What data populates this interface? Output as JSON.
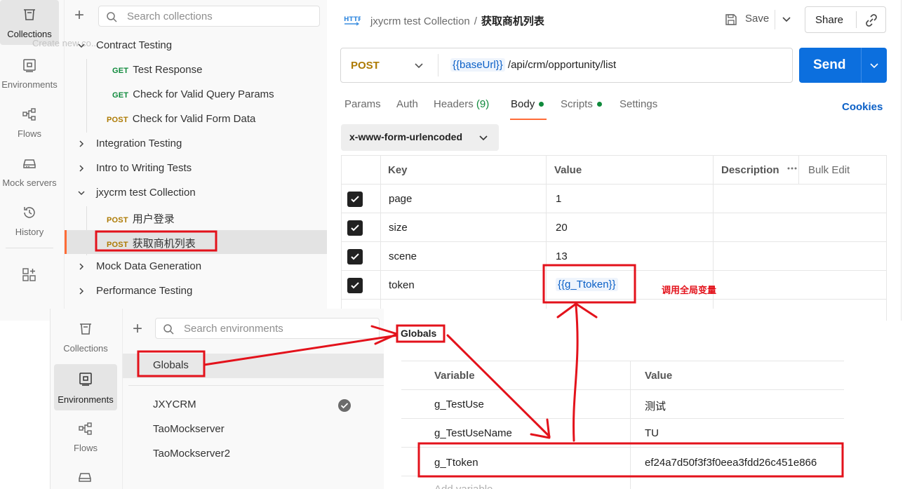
{
  "rail": {
    "items": [
      {
        "label": "Collections",
        "icon": "collections-icon"
      },
      {
        "label": "Environments",
        "icon": "environments-icon"
      },
      {
        "label": "Flows",
        "icon": "flows-icon"
      },
      {
        "label": "Mock servers",
        "icon": "mock-servers-icon"
      },
      {
        "label": "History",
        "icon": "history-icon"
      }
    ],
    "more_icon": "add-workspace-icon"
  },
  "collections": {
    "search_placeholder": "Search collections",
    "ghost_text": "Create new co...",
    "rows": [
      {
        "kind": "folder",
        "open": true,
        "label": "Contract Testing"
      },
      {
        "kind": "request",
        "method": "GET",
        "label": "Test Response"
      },
      {
        "kind": "request",
        "method": "GET",
        "label": "Check for Valid Query Params"
      },
      {
        "kind": "request",
        "method": "POST",
        "label": "Check for Valid Form Data"
      },
      {
        "kind": "folder",
        "open": false,
        "label": "Integration Testing"
      },
      {
        "kind": "folder",
        "open": false,
        "label": "Intro to Writing Tests"
      },
      {
        "kind": "folder",
        "open": true,
        "label": "jxycrm test Collection"
      },
      {
        "kind": "request",
        "method": "POST",
        "label": "用户登录"
      },
      {
        "kind": "request",
        "method": "POST",
        "label": "获取商机列表",
        "selected": true
      },
      {
        "kind": "folder",
        "open": false,
        "label": "Mock Data Generation"
      },
      {
        "kind": "folder",
        "open": false,
        "label": "Performance Testing"
      }
    ]
  },
  "request": {
    "breadcrumb_parent": "jxycrm test Collection",
    "breadcrumb_sep": "/",
    "breadcrumb_current": "获取商机列表",
    "save_label": "Save",
    "share_label": "Share",
    "method": "POST",
    "url_var": "{{baseUrl}}",
    "url_path": " /api/crm/opportunity/list",
    "send_label": "Send",
    "tabs": {
      "params": "Params",
      "auth": "Auth",
      "headers": "Headers",
      "headers_count": "(9)",
      "body": "Body",
      "scripts": "Scripts",
      "settings": "Settings"
    },
    "cookies_label": "Cookies",
    "body_type": "x-www-form-urlencoded",
    "table": {
      "headers": [
        "Key",
        "Value",
        "Description"
      ],
      "bulk_edit": "Bulk Edit",
      "rows": [
        {
          "key": "page",
          "value": "1"
        },
        {
          "key": "size",
          "value": "20"
        },
        {
          "key": "scene",
          "value": "13"
        },
        {
          "key": "token",
          "value": "{{g_Ttoken}}"
        }
      ]
    }
  },
  "annotation": {
    "note": "调用全局变量",
    "color": "#e3121b"
  },
  "environments_panel": {
    "rail": [
      {
        "label": "Collections"
      },
      {
        "label": "Environments"
      },
      {
        "label": "Flows"
      }
    ],
    "search_placeholder": "Search environments",
    "items": [
      {
        "label": "Globals",
        "selected": true
      },
      {
        "label": "JXYCRM",
        "active": true
      },
      {
        "label": "TaoMockserver"
      },
      {
        "label": "TaoMockserver2"
      }
    ],
    "title": "Globals",
    "table": {
      "headers": [
        "Variable",
        "Value"
      ],
      "rows": [
        {
          "variable": "g_TestUse",
          "value": "测试"
        },
        {
          "variable": "g_TestUseName",
          "value": "TU"
        },
        {
          "variable": "g_Ttoken",
          "value": "ef24a7d50f3f3f0eea3fdd26c451e866"
        }
      ],
      "add_placeholder": "Add variable"
    }
  },
  "colors": {
    "accent": "#ff6c37",
    "send": "#0c6fde",
    "post": "#ad7a03",
    "get": "#0f8a3c",
    "annotation": "#e3121b"
  }
}
